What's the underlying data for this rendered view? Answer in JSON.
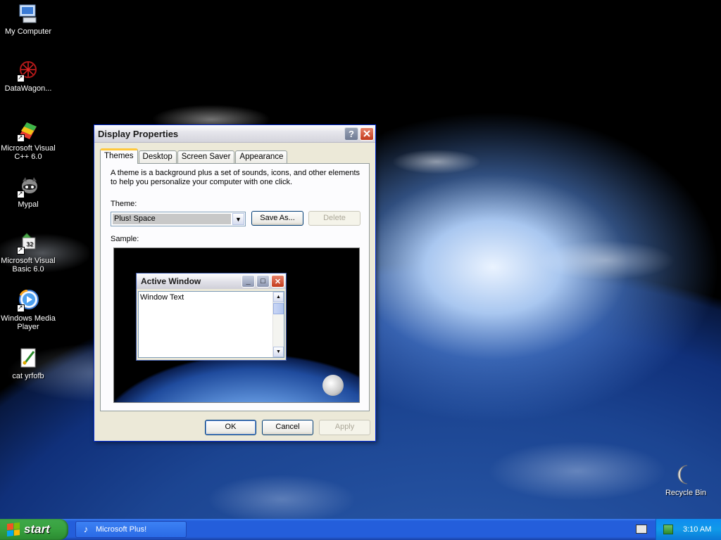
{
  "desktop": {
    "icons": [
      {
        "label": "My Computer",
        "icon": "computer-icon"
      },
      {
        "label": "DataWagon...",
        "icon": "datawagon-icon"
      },
      {
        "label": "Microsoft Visual C++ 6.0",
        "icon": "visual-cpp-icon"
      },
      {
        "label": "Mypal",
        "icon": "mypal-icon"
      },
      {
        "label": "Microsoft Visual Basic 6.0",
        "icon": "visual-basic-icon"
      },
      {
        "label": "Windows Media Player",
        "icon": "media-player-icon"
      },
      {
        "label": "cat yrfofb",
        "icon": "paint-file-icon"
      },
      {
        "label": "Recycle Bin",
        "icon": "recycle-bin-icon"
      }
    ]
  },
  "dialog": {
    "title": "Display Properties",
    "help_button": "?",
    "tabs": [
      "Themes",
      "Desktop",
      "Screen Saver",
      "Appearance"
    ],
    "active_tab": "Themes",
    "description": "A theme is a background plus a set of sounds, icons, and other elements to help you personalize your computer with one click.",
    "theme_label": "Theme:",
    "theme_value": "Plus! Space",
    "save_as_label": "Save As...",
    "delete_label": "Delete",
    "sample_label": "Sample:",
    "sample": {
      "window_title": "Active Window",
      "window_text": "Window Text"
    },
    "ok_label": "OK",
    "cancel_label": "Cancel",
    "apply_label": "Apply"
  },
  "taskbar": {
    "start_label": "start",
    "task_label": "Microsoft Plus!",
    "clock": "3:10 AM"
  },
  "colors": {
    "xp_blue": "#245edb",
    "start_green": "#37a13e",
    "close_red": "#c33a1c",
    "active_tab_accent": "#ffc83c"
  }
}
